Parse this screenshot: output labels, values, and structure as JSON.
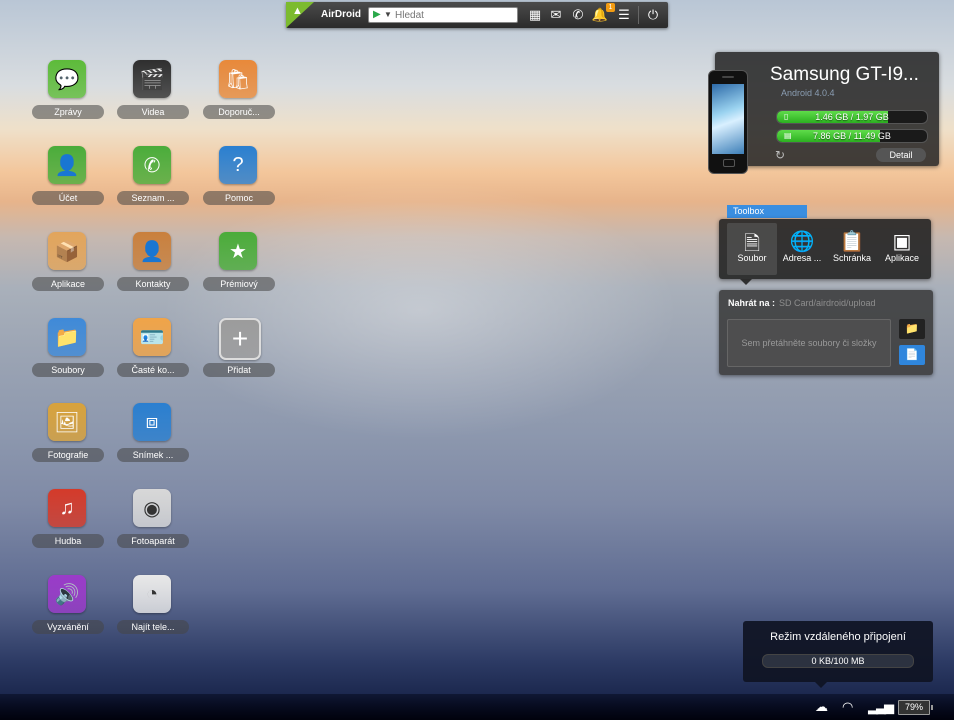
{
  "topbar": {
    "brand": "AirDroid",
    "search_placeholder": "Hledat",
    "notification_count": "1"
  },
  "apps": [
    {
      "label": "Zprávy",
      "icon": "message-icon",
      "color": "#5dbb3a"
    },
    {
      "label": "Videa",
      "icon": "clapperboard-icon",
      "color": "#2f2f2f"
    },
    {
      "label": "Doporuč...",
      "icon": "shopping-bag-icon",
      "color": "#e8893a"
    },
    {
      "label": "Účet",
      "icon": "user-icon",
      "color": "#4aac3a"
    },
    {
      "label": "Seznam ...",
      "icon": "phone-icon",
      "color": "#4aac3a"
    },
    {
      "label": "Pomoc",
      "icon": "help-icon",
      "color": "#2a7fd0"
    },
    {
      "label": "Aplikace",
      "icon": "package-icon",
      "color": "#e2a55c"
    },
    {
      "label": "Kontakty",
      "icon": "address-book-icon",
      "color": "#c9803d"
    },
    {
      "label": "Prémiový",
      "icon": "star-icon",
      "color": "#4aac3a"
    },
    {
      "label": "Soubory",
      "icon": "folder-icon",
      "color": "#3f8ad8"
    },
    {
      "label": "Časté ko...",
      "icon": "contact-card-icon",
      "color": "#f0a448"
    },
    {
      "label": "Přidat",
      "icon": "plus-icon",
      "color": "#9c9c9c"
    },
    {
      "label": "Fotografie",
      "icon": "photo-icon",
      "color": "#d8a23c"
    },
    {
      "label": "Snímek ...",
      "icon": "crop-icon",
      "color": "#2a7fd0"
    },
    {
      "label": "Hudba",
      "icon": "music-icon",
      "color": "#d43a2a"
    },
    {
      "label": "Fotoaparát",
      "icon": "camera-icon",
      "color": "#d8d8d8"
    },
    {
      "label": "Vyzvánění",
      "icon": "speaker-icon",
      "color": "#9a3bc9"
    },
    {
      "label": "Najít tele...",
      "icon": "radar-icon",
      "color": "#e8e8e8"
    }
  ],
  "device": {
    "name": "Samsung GT-I9...",
    "os": "Android 4.0.4",
    "storage": [
      {
        "text": "1.46 GB / 1.97 GB",
        "fraction": 0.741
      },
      {
        "text": "7.86 GB / 11.49 GB",
        "fraction": 0.684
      }
    ],
    "detail_label": "Detail"
  },
  "toolbox": {
    "tab_label": "Toolbox",
    "tools": [
      {
        "label": "Soubor",
        "icon": "file-icon",
        "active": true
      },
      {
        "label": "Adresa ...",
        "icon": "globe-icon",
        "active": false
      },
      {
        "label": "Schránka",
        "icon": "clipboard-icon",
        "active": false
      },
      {
        "label": "Aplikace",
        "icon": "apps-icon",
        "active": false
      }
    ]
  },
  "upload": {
    "label": "Nahrát na :",
    "path": "SD Card/airdroid/upload",
    "dropzone_text": "Sem přetáhněte soubory či složky"
  },
  "remote": {
    "title": "Režim vzdáleného připojení",
    "usage": "0 KB/100 MB"
  },
  "status": {
    "battery": "79%"
  }
}
